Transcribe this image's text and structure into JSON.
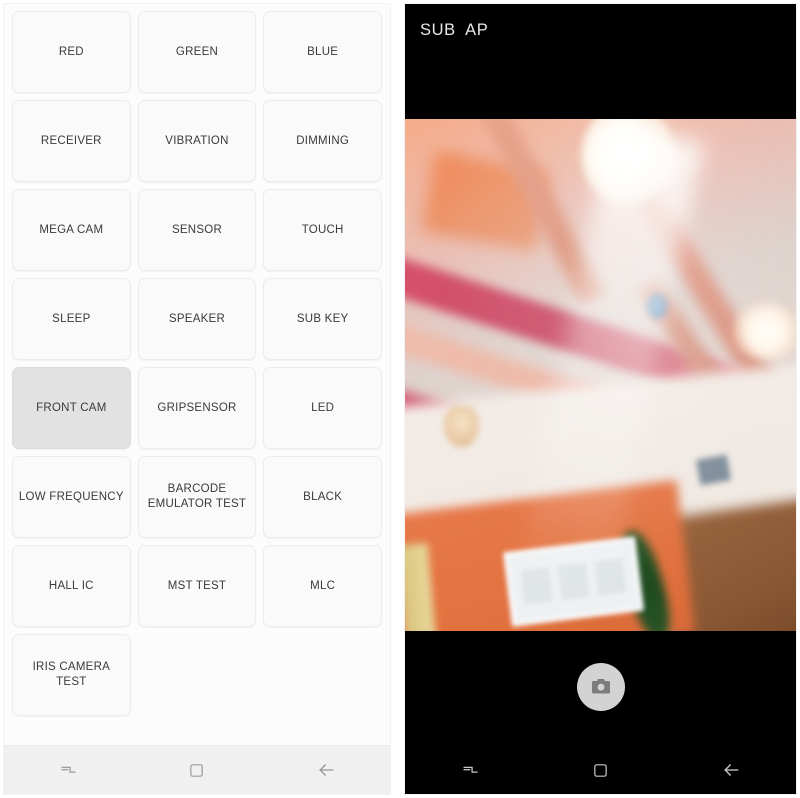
{
  "left_panel": {
    "name": "factory-test-menu",
    "buttons": [
      {
        "label": "RED",
        "selected": false
      },
      {
        "label": "GREEN",
        "selected": false
      },
      {
        "label": "BLUE",
        "selected": false
      },
      {
        "label": "RECEIVER",
        "selected": false
      },
      {
        "label": "VIBRATION",
        "selected": false
      },
      {
        "label": "DIMMING",
        "selected": false
      },
      {
        "label": "MEGA CAM",
        "selected": false
      },
      {
        "label": "SENSOR",
        "selected": false
      },
      {
        "label": "TOUCH",
        "selected": false
      },
      {
        "label": "SLEEP",
        "selected": false
      },
      {
        "label": "SPEAKER",
        "selected": false
      },
      {
        "label": "SUB KEY",
        "selected": false
      },
      {
        "label": "FRONT CAM",
        "selected": true
      },
      {
        "label": "GRIPSENSOR",
        "selected": false
      },
      {
        "label": "LED",
        "selected": false
      },
      {
        "label": "LOW FREQUENCY",
        "selected": false
      },
      {
        "label": "BARCODE\nEMULATOR TEST",
        "selected": false
      },
      {
        "label": "BLACK",
        "selected": false
      },
      {
        "label": "HALL IC",
        "selected": false
      },
      {
        "label": "MST TEST",
        "selected": false
      },
      {
        "label": "MLC",
        "selected": false
      },
      {
        "label": "IRIS CAMERA TEST",
        "selected": false
      }
    ],
    "navbar": {
      "recents_icon": "recents-icon",
      "home_icon": "home-square-icon",
      "back_icon": "back-arrow-icon"
    }
  },
  "right_panel": {
    "name": "front-camera-test",
    "header_text": "SUB  AP",
    "preview_alt": "blurry indoor ceiling photo with wooden beams and bright ceiling lamp",
    "shutter_icon": "camera-icon",
    "navbar": {
      "recents_icon": "recents-icon",
      "home_icon": "home-square-icon",
      "back_icon": "back-arrow-icon"
    }
  },
  "colors": {
    "button_bg": "#fafafa",
    "button_selected_bg": "#e2e2e2",
    "button_text": "#3a3a3a",
    "panel_bg": "#fcfcfc",
    "navbar_light_bg": "#f0f0f0",
    "navbar_dark_bg": "#000000",
    "header_text": "#e8e8e8",
    "shutter_bg": "#d3d3d3",
    "camera_black": "#000000"
  }
}
